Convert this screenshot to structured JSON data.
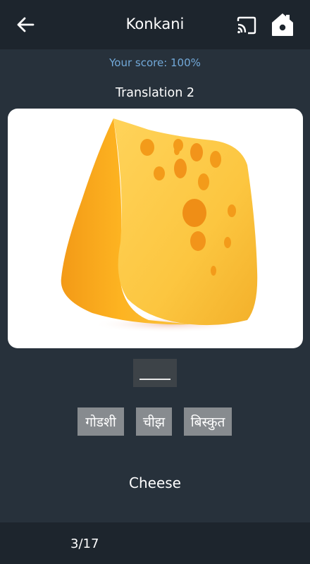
{
  "header": {
    "title": "Konkani",
    "back_icon": "arrow-left-icon",
    "cast_icon": "cast-icon",
    "home_icon": "home-icon"
  },
  "score": {
    "text": "Your score: 100%"
  },
  "exercise": {
    "subtitle": "Translation 2",
    "image": "cheese-image",
    "answer_blank": "",
    "options": [
      {
        "label": "गोडशी"
      },
      {
        "label": "चीझ"
      },
      {
        "label": "बिस्कुत"
      }
    ],
    "english_word": "Cheese"
  },
  "footer": {
    "progress": "3/17"
  },
  "colors": {
    "background": "#27313b",
    "bar": "#1d252d",
    "score_text": "#72a9d9",
    "option_bg": "#878b8f",
    "answer_slot_bg": "#3d4348"
  }
}
